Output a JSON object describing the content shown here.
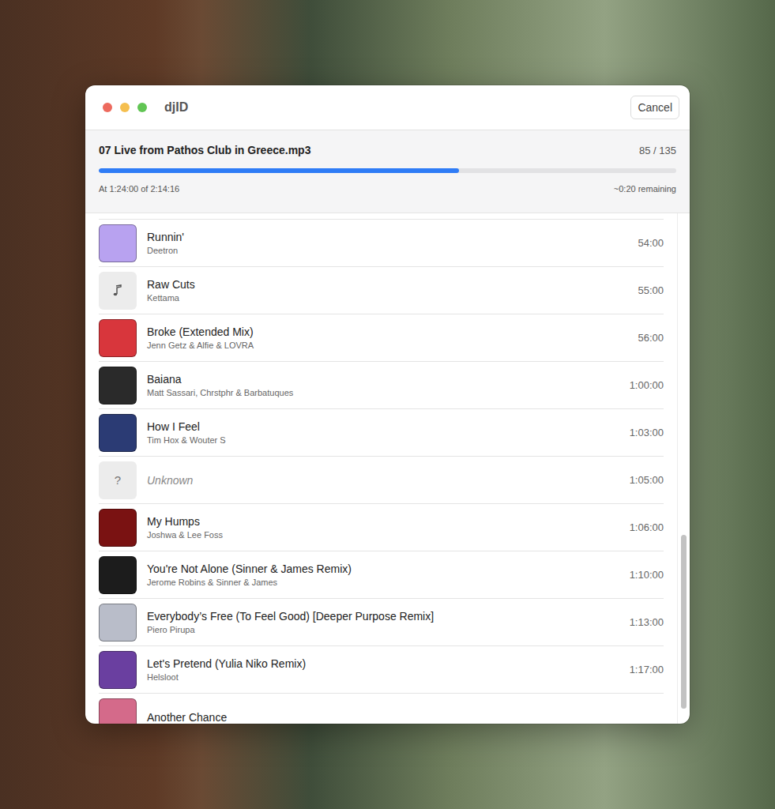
{
  "window": {
    "title": "djID",
    "cancel_button": "Cancel"
  },
  "job": {
    "file": "07 Live from Pathos Club in Greece.mp3",
    "count": "85 / 135",
    "level": 0.624,
    "position": "At 1:24:00 of 2:14:16",
    "remaining": "~0:20 remaining"
  },
  "scroll": {
    "start": 0.63,
    "visible": 0.34
  },
  "tracks": [
    {
      "title": "Runnin'",
      "artist": "Deetron",
      "time": "54:00",
      "identified": true,
      "artwork": {
        "kind": "image",
        "color": "#b8a2f0"
      }
    },
    {
      "title": "Raw Cuts",
      "artist": "Kettama",
      "time": "55:00",
      "identified": true,
      "artwork": {
        "kind": "none"
      }
    },
    {
      "title": "Broke (Extended Mix)",
      "artist": "Jenn Getz & Alfie & LOVRA",
      "time": "56:00",
      "identified": true,
      "artwork": {
        "kind": "image",
        "color": "#d8363c"
      }
    },
    {
      "title": "Baiana",
      "artist": "Matt Sassari, Chrstphr & Barbatuques",
      "time": "1:00:00",
      "identified": true,
      "artwork": {
        "kind": "image",
        "color": "#2a2a2a"
      }
    },
    {
      "title": "How I Feel",
      "artist": "Tim Hox & Wouter S",
      "time": "1:03:00",
      "identified": true,
      "artwork": {
        "kind": "image",
        "color": "#2b3b74"
      }
    },
    {
      "title": "Unknown",
      "time": "1:05:00",
      "identified": false,
      "artwork": {
        "kind": "unknown",
        "glyph": "?"
      }
    },
    {
      "title": "My Humps",
      "artist": "Joshwa & Lee Foss",
      "time": "1:06:00",
      "identified": true,
      "artwork": {
        "kind": "image",
        "color": "#7a1212"
      }
    },
    {
      "title": "You're Not Alone (Sinner & James Remix)",
      "artist": "Jerome Robins & Sinner & James",
      "time": "1:10:00",
      "identified": true,
      "artwork": {
        "kind": "image",
        "color": "#1c1c1c"
      }
    },
    {
      "title": "Everybody’s Free (To Feel Good) [Deeper Purpose Remix]",
      "artist": "Piero Pirupa",
      "time": "1:13:00",
      "identified": true,
      "artwork": {
        "kind": "image",
        "color": "#b9bdc9"
      }
    },
    {
      "title": "Let's Pretend (Yulia Niko Remix)",
      "artist": "Helsloot",
      "time": "1:17:00",
      "identified": true,
      "artwork": {
        "kind": "image",
        "color": "#6a3fa0"
      }
    },
    {
      "title": "Another Chance",
      "identified": true,
      "artwork": {
        "kind": "image",
        "color": "#d46a8a"
      }
    }
  ]
}
